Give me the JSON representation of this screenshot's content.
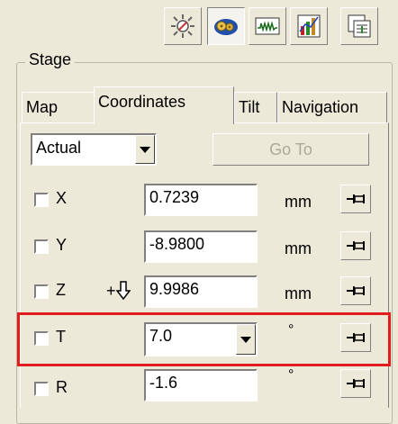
{
  "toolbar": {
    "buttons": [
      {
        "icon": "sun-settings-icon",
        "pressed": false
      },
      {
        "icon": "gears-icon",
        "pressed": true
      },
      {
        "icon": "waveform-icon",
        "pressed": false
      },
      {
        "icon": "bar-chart-icon",
        "pressed": false
      },
      {
        "icon": "window-list-icon",
        "pressed": false
      }
    ]
  },
  "stage": {
    "title": "Stage",
    "tabs": [
      "Map",
      "Coordinates",
      "Tilt",
      "Navigation"
    ],
    "active_tab": "Coordinates"
  },
  "mode_select": {
    "value": "Actual"
  },
  "goto_button": {
    "label": "Go To",
    "enabled": false
  },
  "rows": [
    {
      "axis": "X",
      "value": "0.7239",
      "unit": "mm"
    },
    {
      "axis": "Y",
      "value": "-8.9800",
      "unit": "mm"
    },
    {
      "axis": "Z",
      "prefix": "+",
      "value": "9.9986",
      "unit": "mm"
    },
    {
      "axis": "T",
      "value": "7.0",
      "unit": "°"
    },
    {
      "axis": "R",
      "value": "-1.6",
      "unit": "°"
    }
  ],
  "colors": {
    "highlight": "#e01c1c",
    "background": "#ece9d8"
  }
}
